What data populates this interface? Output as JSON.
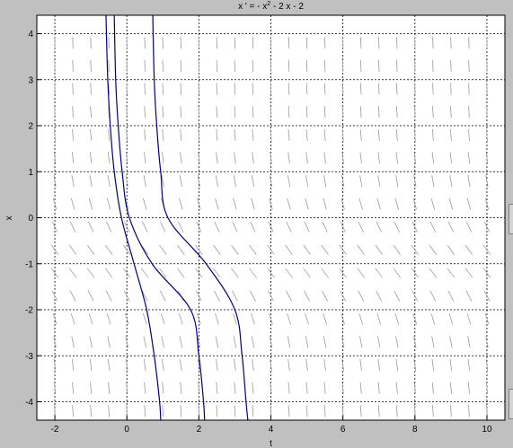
{
  "chart_data": {
    "type": "line",
    "title_parts": [
      "x ' = - x",
      "2",
      " - 2 x - 2"
    ],
    "xlabel": "t",
    "ylabel": "x",
    "xlim": [
      -2.5,
      10.5
    ],
    "ylim": [
      -4.4,
      4.4
    ],
    "xticks": [
      -2,
      0,
      2,
      4,
      6,
      8,
      10
    ],
    "yticks": [
      -4,
      -3,
      -2,
      -1,
      0,
      1,
      2,
      3,
      4
    ],
    "grid": "dashed",
    "direction_field": "x' = -x^2 - 2x - 2",
    "colors": {
      "curve": "#000080",
      "arrows": "#9a9a9a",
      "grid": "#000000",
      "background": "#c0c0c0",
      "axes_bg": "#ffffff"
    },
    "series": [
      {
        "t0": 0.2,
        "x": [
          [
            -0.58,
            4.4
          ],
          [
            -0.53,
            3.0
          ],
          [
            -0.46,
            2.0
          ],
          [
            -0.35,
            1.0
          ],
          [
            -0.15,
            0.0
          ],
          [
            0.2,
            -1.0
          ],
          [
            0.55,
            -2.0
          ],
          [
            0.76,
            -3.0
          ],
          [
            0.91,
            -4.0
          ],
          [
            0.94,
            -4.4
          ]
        ]
      },
      {
        "t0": 0.7,
        "x": [
          [
            -0.35,
            4.4
          ],
          [
            -0.31,
            3.0
          ],
          [
            -0.24,
            2.0
          ],
          [
            -0.13,
            1.0
          ],
          [
            0.07,
            0.0
          ],
          [
            0.7,
            -1.0
          ],
          [
            1.77,
            -2.0
          ],
          [
            2.0,
            -3.0
          ],
          [
            2.13,
            -4.0
          ],
          [
            2.16,
            -4.4
          ]
        ]
      },
      {
        "t0": 2.2,
        "x": [
          [
            0.72,
            4.4
          ],
          [
            0.76,
            3.0
          ],
          [
            0.83,
            2.0
          ],
          [
            0.94,
            1.0
          ],
          [
            1.14,
            0.0
          ],
          [
            2.2,
            -1.0
          ],
          [
            3.0,
            -2.0
          ],
          [
            3.2,
            -3.0
          ],
          [
            3.31,
            -4.0
          ],
          [
            3.36,
            -4.4
          ]
        ]
      }
    ]
  }
}
